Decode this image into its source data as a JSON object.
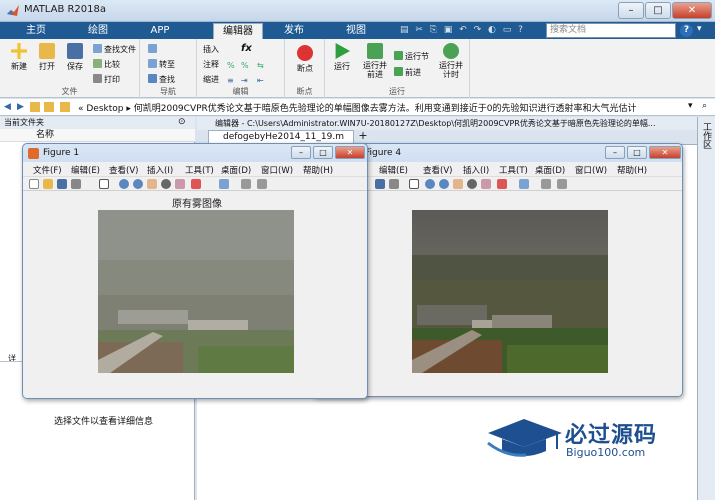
{
  "window": {
    "title": "MATLAB R2018a",
    "min": "–",
    "max": "□",
    "close": "✕"
  },
  "tabs": [
    {
      "label": "主页",
      "active": false
    },
    {
      "label": "绘图",
      "active": false
    },
    {
      "label": "APP",
      "active": false
    },
    {
      "label": "编辑器",
      "active": true
    },
    {
      "label": "发布",
      "active": false
    },
    {
      "label": "视图",
      "active": false
    }
  ],
  "search": {
    "placeholder": "搜索文档"
  },
  "ribbon": {
    "file": {
      "new": "新建",
      "open": "打开",
      "save": "保存",
      "find_files": "查找文件",
      "compare": "比较",
      "print": "打印",
      "group": "文件"
    },
    "navigate": {
      "goto": "转至",
      "find": "查找",
      "group": "导航"
    },
    "edit": {
      "insert": "插入",
      "comment": "注释",
      "indent": "缩进",
      "fx": "fx",
      "group": "编辑"
    },
    "breakpoints": {
      "breakpoint": "断点",
      "group": "断点"
    },
    "run": {
      "run": "运行",
      "run_advance": "运行并\n前进",
      "run_section": "运行节",
      "advance": "前进",
      "run_time": "运行并\n计时",
      "group": "运行"
    }
  },
  "address": {
    "folder": "Desktop",
    "path": "何凯明2009CVPR优秀论文基于暗原色先验理论的单幅图像去雾方法。利用变通到接近于0的先验知识进行透射率和大气光估计"
  },
  "current_folder": {
    "title": "当前文件夹",
    "column": "名称",
    "details_hint": "选择文件以查看详细信息",
    "detail_label": "详"
  },
  "editor": {
    "header": "编辑器 - C:\\Users\\Administrator.WIN7U-20180127Z\\Desktop\\何凯明2009CVPR优秀论文基于暗原色先验理论的单幅...",
    "tab": "defogebyHe2014_11_19.m",
    "add": "+"
  },
  "workspace_label": "工作区",
  "figure1": {
    "title": "Figure 1",
    "plot_title": "原有雾图像"
  },
  "figure4": {
    "title": "Figure 4"
  },
  "fig_menu": [
    "文件(F)",
    "编辑(E)",
    "查看(V)",
    "插入(I)",
    "工具(T)",
    "桌面(D)",
    "窗口(W)",
    "帮助(H)"
  ],
  "watermark": {
    "cn": "必过源码",
    "en": "Biguo100.com"
  },
  "colors": {
    "tabstrip": "#1f5a93",
    "accent": "#2c6fb7"
  }
}
